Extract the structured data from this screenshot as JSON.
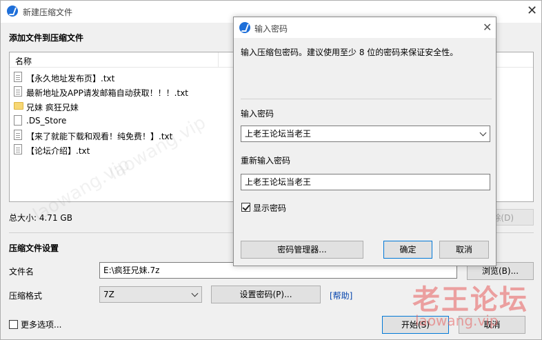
{
  "main_window": {
    "title": "新建压缩文件",
    "add_section_title": "添加文件到压缩文件",
    "column_name": "名称",
    "files": [
      {
        "name": "【永久地址发布页】.txt",
        "icon": "text-file-icon"
      },
      {
        "name": "最新地址及APP请发邮箱自动获取！！！.txt",
        "icon": "text-file-icon"
      },
      {
        "name": "兄妹 疯狂兄妹",
        "icon": "folder-icon"
      },
      {
        "name": ".DS_Store",
        "icon": "file-icon"
      },
      {
        "name": "【来了就能下载和观看！纯免费！】.txt",
        "icon": "text-file-icon"
      },
      {
        "name": "【论坛介绍】.txt",
        "icon": "text-file-icon"
      }
    ],
    "total_size": "总大小: 4.71 GB",
    "delete_button": "除(D)",
    "settings_title": "压缩文件设置",
    "filename_label": "文件名",
    "filename_value": "E:\\疯狂兄妹.7z",
    "browse_button": "浏览(B)...",
    "format_label": "压缩格式",
    "format_value": "7Z",
    "set_password_button": "设置密码(P)...",
    "help_link": "[帮助]",
    "more_options_label": "更多选项...",
    "start_button": "开始(S)",
    "cancel_button": "取消"
  },
  "password_dialog": {
    "title": "输入密码",
    "description": "输入压缩包密码。建议使用至少 8 位的密码来保证安全性。",
    "password_label": "输入密码",
    "password_value": "上老王论坛当老王",
    "confirm_label": "重新输入密码",
    "confirm_value": "上老王论坛当老王",
    "show_password_label": "显示密码",
    "show_password_checked": true,
    "manager_button": "密码管理器...",
    "ok_button": "确定",
    "cancel_button": "取消"
  },
  "watermark": {
    "brand": "老王论坛",
    "url": "laowang.vip"
  },
  "colors": {
    "accent": "#1e6fd9",
    "link": "#0645ad",
    "watermark": "#e85c5c"
  }
}
